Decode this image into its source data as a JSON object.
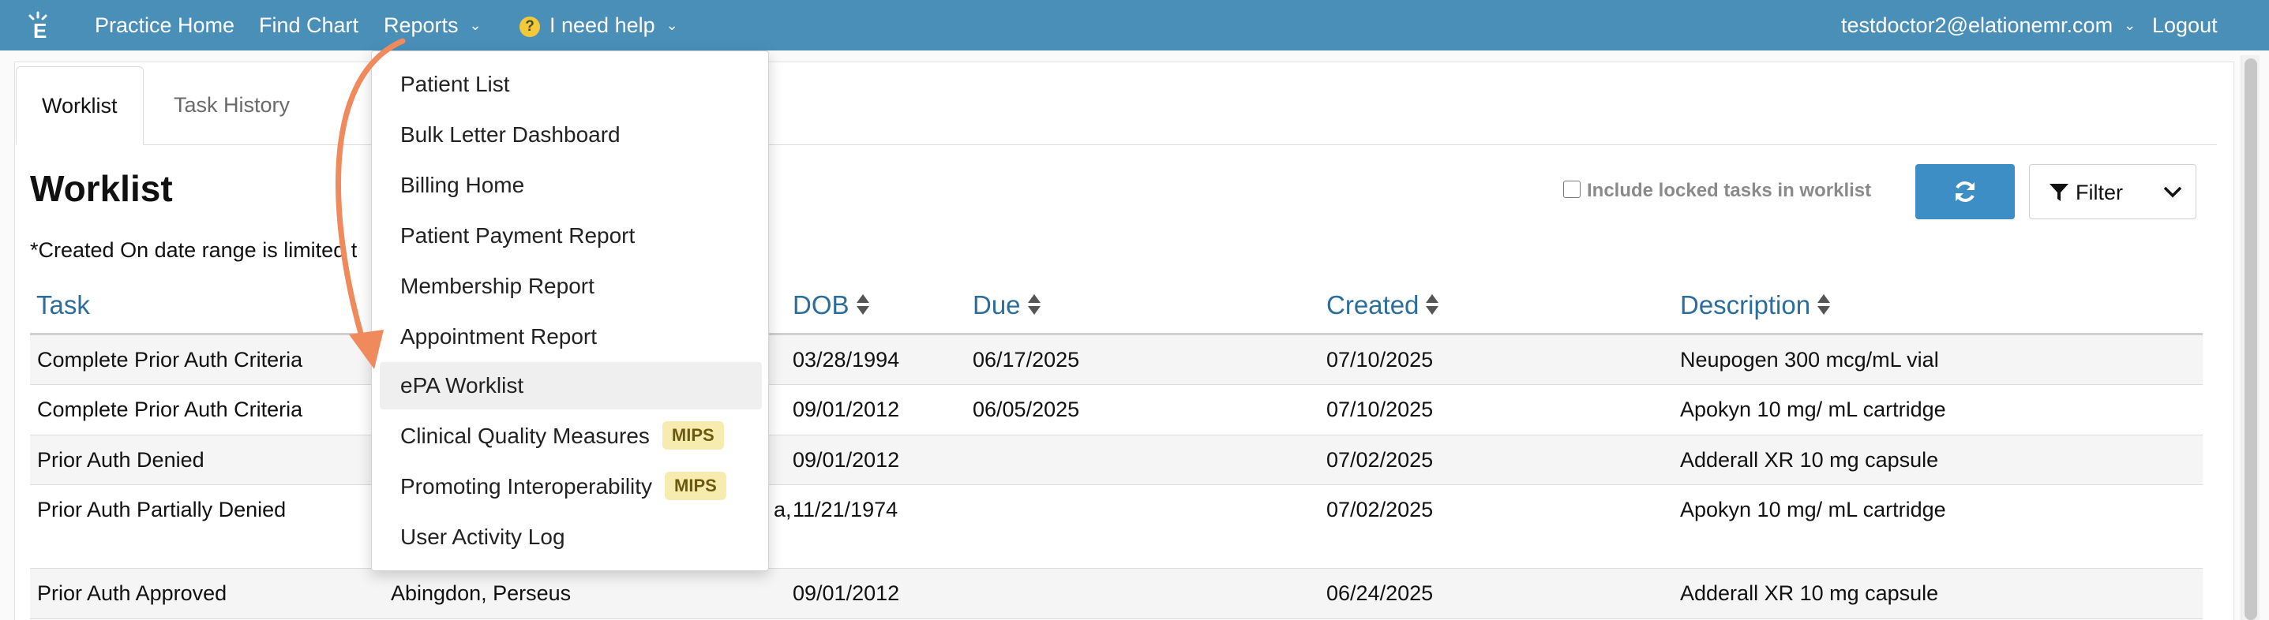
{
  "nav": {
    "logo": "elation-logo-icon",
    "practice_home": "Practice Home",
    "find_chart": "Find Chart",
    "reports": "Reports",
    "help": "I need help",
    "user": "testdoctor2@elationemr.com",
    "logout": "Logout"
  },
  "tabs": [
    {
      "label": "Worklist",
      "active": true
    },
    {
      "label": "Task History",
      "active": false
    }
  ],
  "page": {
    "title": "Worklist",
    "range_note": "*Created On date range is limited t",
    "include_locked": "Include locked tasks in worklist",
    "filter_label": "Filter"
  },
  "table": {
    "headers": [
      "Task",
      "DOB",
      "Due",
      "Created",
      "Description"
    ],
    "rows": [
      {
        "task": "Complete Prior Auth Criteria",
        "patient": "",
        "dob": "03/28/1994",
        "due": "06/17/2025",
        "created": "07/10/2025",
        "description": "Neupogen 300 mcg/mL vial"
      },
      {
        "task": "Complete Prior Auth Criteria",
        "patient": "",
        "dob": "09/01/2012",
        "due": "06/05/2025",
        "created": "07/10/2025",
        "description": "Apokyn 10 mg/ mL cartridge"
      },
      {
        "task": "Prior Auth Denied",
        "patient": "",
        "dob": "09/01/2012",
        "due": "",
        "created": "07/02/2025",
        "description": "Adderall XR 10 mg capsule"
      },
      {
        "task": "Prior Auth Partially Denied",
        "patient": "a,",
        "dob": "11/21/1974",
        "due": "",
        "created": "07/02/2025",
        "description": "Apokyn 10 mg/ mL cartridge"
      },
      {
        "task": "Prior Auth Approved",
        "patient": "Abingdon, Perseus",
        "dob": "09/01/2012",
        "due": "",
        "created": "06/24/2025",
        "description": "Adderall XR 10 mg capsule"
      }
    ]
  },
  "reports_menu": {
    "items": [
      {
        "label": "Patient List",
        "badge": ""
      },
      {
        "label": "Bulk Letter Dashboard",
        "badge": ""
      },
      {
        "label": "Billing Home",
        "badge": ""
      },
      {
        "label": "Patient Payment Report",
        "badge": ""
      },
      {
        "label": "Membership Report",
        "badge": ""
      },
      {
        "label": "Appointment Report",
        "badge": ""
      },
      {
        "label": "ePA Worklist",
        "badge": ""
      },
      {
        "label": "Clinical Quality Measures",
        "badge": "MIPS"
      },
      {
        "label": "Promoting Interoperability",
        "badge": "MIPS"
      },
      {
        "label": "User Activity Log",
        "badge": ""
      }
    ],
    "highlighted": "ePA Worklist"
  },
  "colors": {
    "nav_bg": "#4a8fb8",
    "link_blue": "#2c6d9c",
    "refresh_btn": "#3e8ec6",
    "badge_bg": "#f7ecb0",
    "arrow": "#f08a5d"
  }
}
